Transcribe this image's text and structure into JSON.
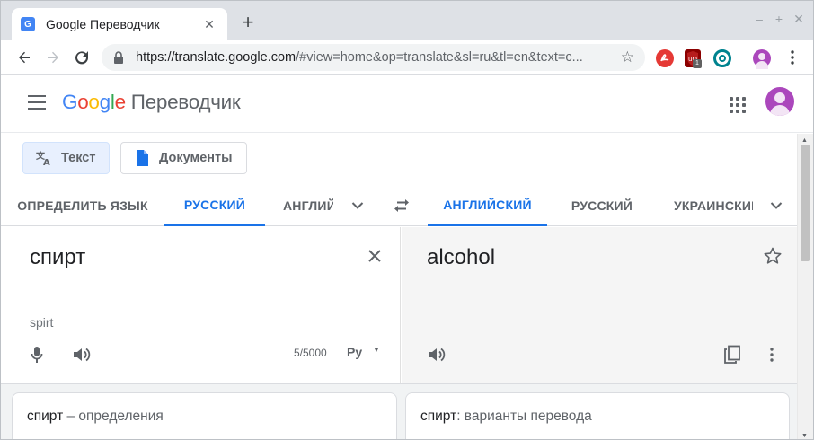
{
  "browser": {
    "tab_title": "Google Переводчик",
    "tab_favicon": "G",
    "tab_close": "✕",
    "new_tab": "+",
    "window_controls": [
      "–",
      "+",
      "✕"
    ],
    "url_host": "https://translate.google.com",
    "url_rest": "/#view=home&op=translate&sl=ru&tl=en&text=c...",
    "extension_badge": "1",
    "icons": [
      "back-arrow-icon",
      "forward-arrow-icon",
      "reload-icon",
      "lock-icon",
      "bookmark-star-icon",
      "extension-icons",
      "profile-icon",
      "kebab-menu-icon"
    ]
  },
  "app": {
    "logo": [
      "G",
      "o",
      "o",
      "g",
      "l",
      "e"
    ],
    "product": "Переводчик",
    "colors": {
      "accent": "#1a73e8",
      "avatar": "#ab47bc"
    }
  },
  "modes": {
    "text": "Текст",
    "documents": "Документы"
  },
  "source_langs": [
    "ОПРЕДЕЛИТЬ ЯЗЫК",
    "РУССКИЙ",
    "АНГЛИЙ"
  ],
  "target_langs": [
    "АНГЛИЙСКИЙ",
    "РУССКИЙ",
    "УКРАИНСКИЙ"
  ],
  "source": {
    "text": "спирт",
    "transliteration": "spirt",
    "char_count": "5/5000",
    "keyboard_label": "Pу",
    "keyboard_caret": "▼"
  },
  "target": {
    "text": "alcohol"
  },
  "cards": {
    "left_word": "спирт",
    "left_rest": " – определения",
    "right_word": "спирт",
    "right_rest": ": варианты перевода"
  },
  "scrollbar": {
    "up": "▲",
    "down": "▼"
  }
}
